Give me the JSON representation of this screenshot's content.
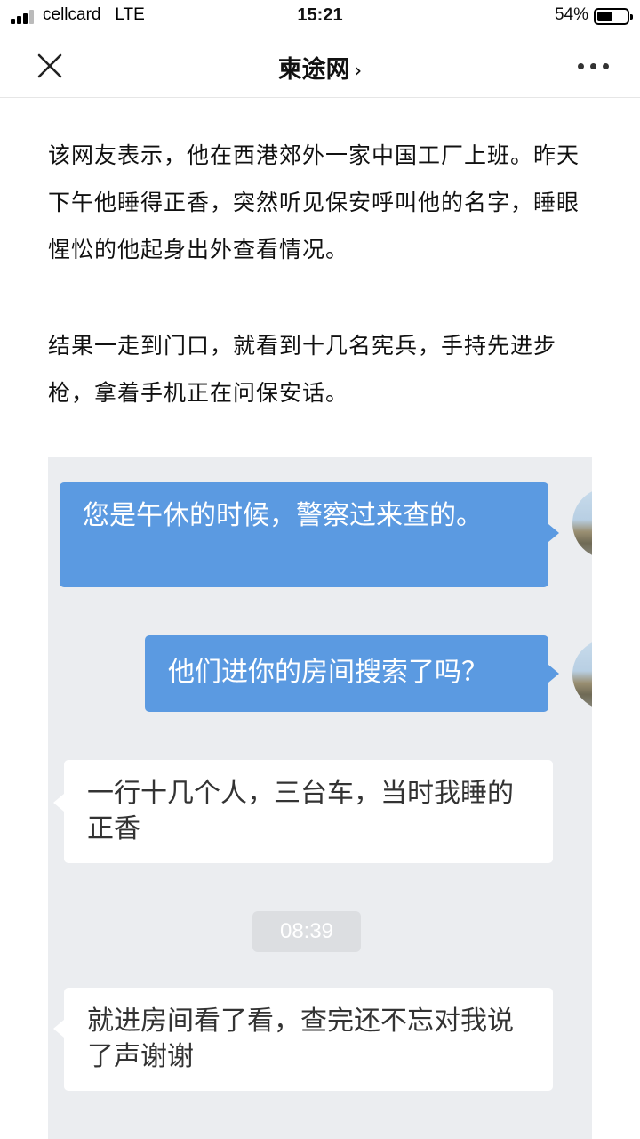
{
  "status_bar": {
    "carrier": "cellcard",
    "network": "LTE",
    "time": "15:21",
    "battery_percent_label": "54%",
    "battery_level": 0.54
  },
  "nav": {
    "title": "柬途网",
    "chevron": "›",
    "close_icon": "close-icon",
    "more_icon": "more-icon"
  },
  "article": {
    "paragraphs": [
      "该网友表示，他在西港郊外一家中国工厂上班。昨天下午他睡得正香，突然听见保安呼叫他的名字，睡眼惺忪的他起身出外查看情况。",
      "结果一走到门口，就看到十几名宪兵，手持先进步枪，拿着手机正在问保安话。"
    ]
  },
  "chat_screenshot": {
    "messages": [
      {
        "side": "right",
        "text": "您是午休的时候，警察过来查的。"
      },
      {
        "side": "right",
        "text": "他们进你的房间搜索了吗？"
      },
      {
        "side": "left",
        "text": "一行十几个人，三台车，当时我睡的正香"
      },
      {
        "side": "left",
        "text": "就进房间看了看，查完还不忘对我说了声谢谢"
      }
    ],
    "timestamp": "08:39",
    "colors": {
      "background": "#ebedf0",
      "outgoing_bubble": "#5b9ae1",
      "incoming_bubble": "#ffffff"
    }
  }
}
